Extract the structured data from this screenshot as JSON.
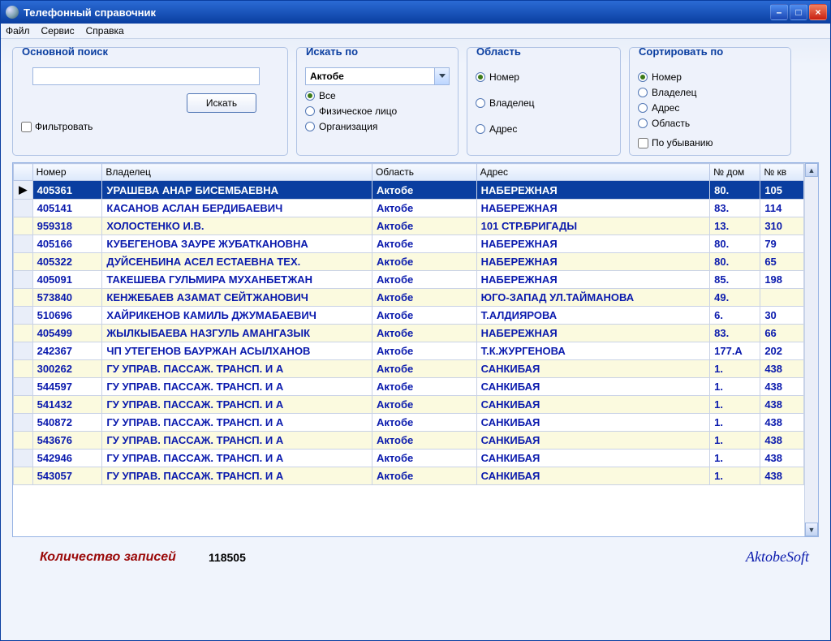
{
  "window": {
    "title": "Телефонный справочник"
  },
  "menu": {
    "file": "Файл",
    "service": "Сервис",
    "help": "Справка"
  },
  "search": {
    "legend": "Основной поиск",
    "value": "",
    "button": "Искать",
    "filter_label": "Фильтровать"
  },
  "searchby": {
    "legend": "Искать по",
    "region_selected": "Актобе",
    "opts": {
      "all": "Все",
      "indiv": "Физическое лицо",
      "org": "Организация"
    }
  },
  "area_grp": {
    "legend": "Область",
    "opts": {
      "number": "Номер",
      "owner": "Владелец",
      "address": "Адрес"
    }
  },
  "sort_grp": {
    "legend": "Сортировать по",
    "opts": {
      "number": "Номер",
      "owner": "Владелец",
      "address": "Адрес",
      "region": "Область"
    },
    "desc_label": "По убыванию"
  },
  "cols": {
    "number": "Номер",
    "owner": "Владелец",
    "region": "Область",
    "address": "Адрес",
    "house": "№ дом",
    "apt": "№ кв"
  },
  "rows": [
    {
      "num": "405361",
      "owner": "УРАШЕВА АНАР БИСЕМБАЕВНА",
      "region": "Актобе",
      "addr": "НАБЕРЕЖНАЯ",
      "house": "80.",
      "apt": "105"
    },
    {
      "num": "405141",
      "owner": "КАСАНОВ АСЛАН БЕРДИБАЕВИЧ",
      "region": "Актобе",
      "addr": "НАБЕРЕЖНАЯ",
      "house": "83.",
      "apt": "114"
    },
    {
      "num": "959318",
      "owner": "ХОЛОСТЕНКО И.В.",
      "region": "Актобе",
      "addr": "101 СТР.БРИГАДЫ",
      "house": "13.",
      "apt": "310"
    },
    {
      "num": "405166",
      "owner": "КУБЕГЕНОВА ЗАУРЕ ЖУБАТКАНОВНА",
      "region": "Актобе",
      "addr": "НАБЕРЕЖНАЯ",
      "house": "80.",
      "apt": "79"
    },
    {
      "num": "405322",
      "owner": "ДУЙСЕНБИНА АСЕЛ ЕСТАЕВНА ТЕХ.",
      "region": "Актобе",
      "addr": "НАБЕРЕЖНАЯ",
      "house": "80.",
      "apt": "65"
    },
    {
      "num": "405091",
      "owner": "ТАКЕШЕВА ГУЛЬМИРА МУХАНБЕТЖАН",
      "region": "Актобе",
      "addr": "НАБЕРЕЖНАЯ",
      "house": "85.",
      "apt": "198"
    },
    {
      "num": "573840",
      "owner": "КЕНЖЕБАЕВ АЗАМАТ СЕЙТЖАНОВИЧ",
      "region": "Актобе",
      "addr": "ЮГО-ЗАПАД УЛ.ТАЙМАНОВА",
      "house": "49.",
      "apt": ""
    },
    {
      "num": "510696",
      "owner": "ХАЙРИКЕНОВ КАМИЛЬ ДЖУМАБАЕВИЧ",
      "region": "Актобе",
      "addr": "Т.АЛДИЯРОВА",
      "house": "6.",
      "apt": "30"
    },
    {
      "num": "405499",
      "owner": "ЖЫЛКЫБАЕВА НАЗГУЛЬ АМАНГАЗЫК",
      "region": "Актобе",
      "addr": "НАБЕРЕЖНАЯ",
      "house": "83.",
      "apt": "66"
    },
    {
      "num": "242367",
      "owner": "ЧП УТЕГЕНОВ БАУРЖАН АСЫЛХАНОВ",
      "region": "Актобе",
      "addr": "Т.К.ЖУРГЕНОВА",
      "house": "177.А",
      "apt": "202"
    },
    {
      "num": "300262",
      "owner": "ГУ  УПРАВ. ПАССАЖ. ТРАНСП. И А",
      "region": "Актобе",
      "addr": "САНКИБАЯ",
      "house": "1.",
      "apt": "438"
    },
    {
      "num": "544597",
      "owner": "ГУ  УПРАВ. ПАССАЖ. ТРАНСП. И А",
      "region": "Актобе",
      "addr": "САНКИБАЯ",
      "house": "1.",
      "apt": "438"
    },
    {
      "num": "541432",
      "owner": "ГУ  УПРАВ. ПАССАЖ. ТРАНСП. И А",
      "region": "Актобе",
      "addr": "САНКИБАЯ",
      "house": "1.",
      "apt": "438"
    },
    {
      "num": "540872",
      "owner": "ГУ  УПРАВ. ПАССАЖ. ТРАНСП. И А",
      "region": "Актобе",
      "addr": "САНКИБАЯ",
      "house": "1.",
      "apt": "438"
    },
    {
      "num": "543676",
      "owner": "ГУ  УПРАВ. ПАССАЖ. ТРАНСП. И А",
      "region": "Актобе",
      "addr": "САНКИБАЯ",
      "house": "1.",
      "apt": "438"
    },
    {
      "num": "542946",
      "owner": "ГУ  УПРАВ. ПАССАЖ. ТРАНСП. И А",
      "region": "Актобе",
      "addr": "САНКИБАЯ",
      "house": "1.",
      "apt": "438"
    },
    {
      "num": "543057",
      "owner": "ГУ  УПРАВ. ПАССАЖ. ТРАНСП. И А",
      "region": "Актобе",
      "addr": "САНКИБАЯ",
      "house": "1.",
      "apt": "438"
    }
  ],
  "footer": {
    "records_label": "Количество записей",
    "records_count": "118505",
    "vendor": "AktobeSoft"
  }
}
